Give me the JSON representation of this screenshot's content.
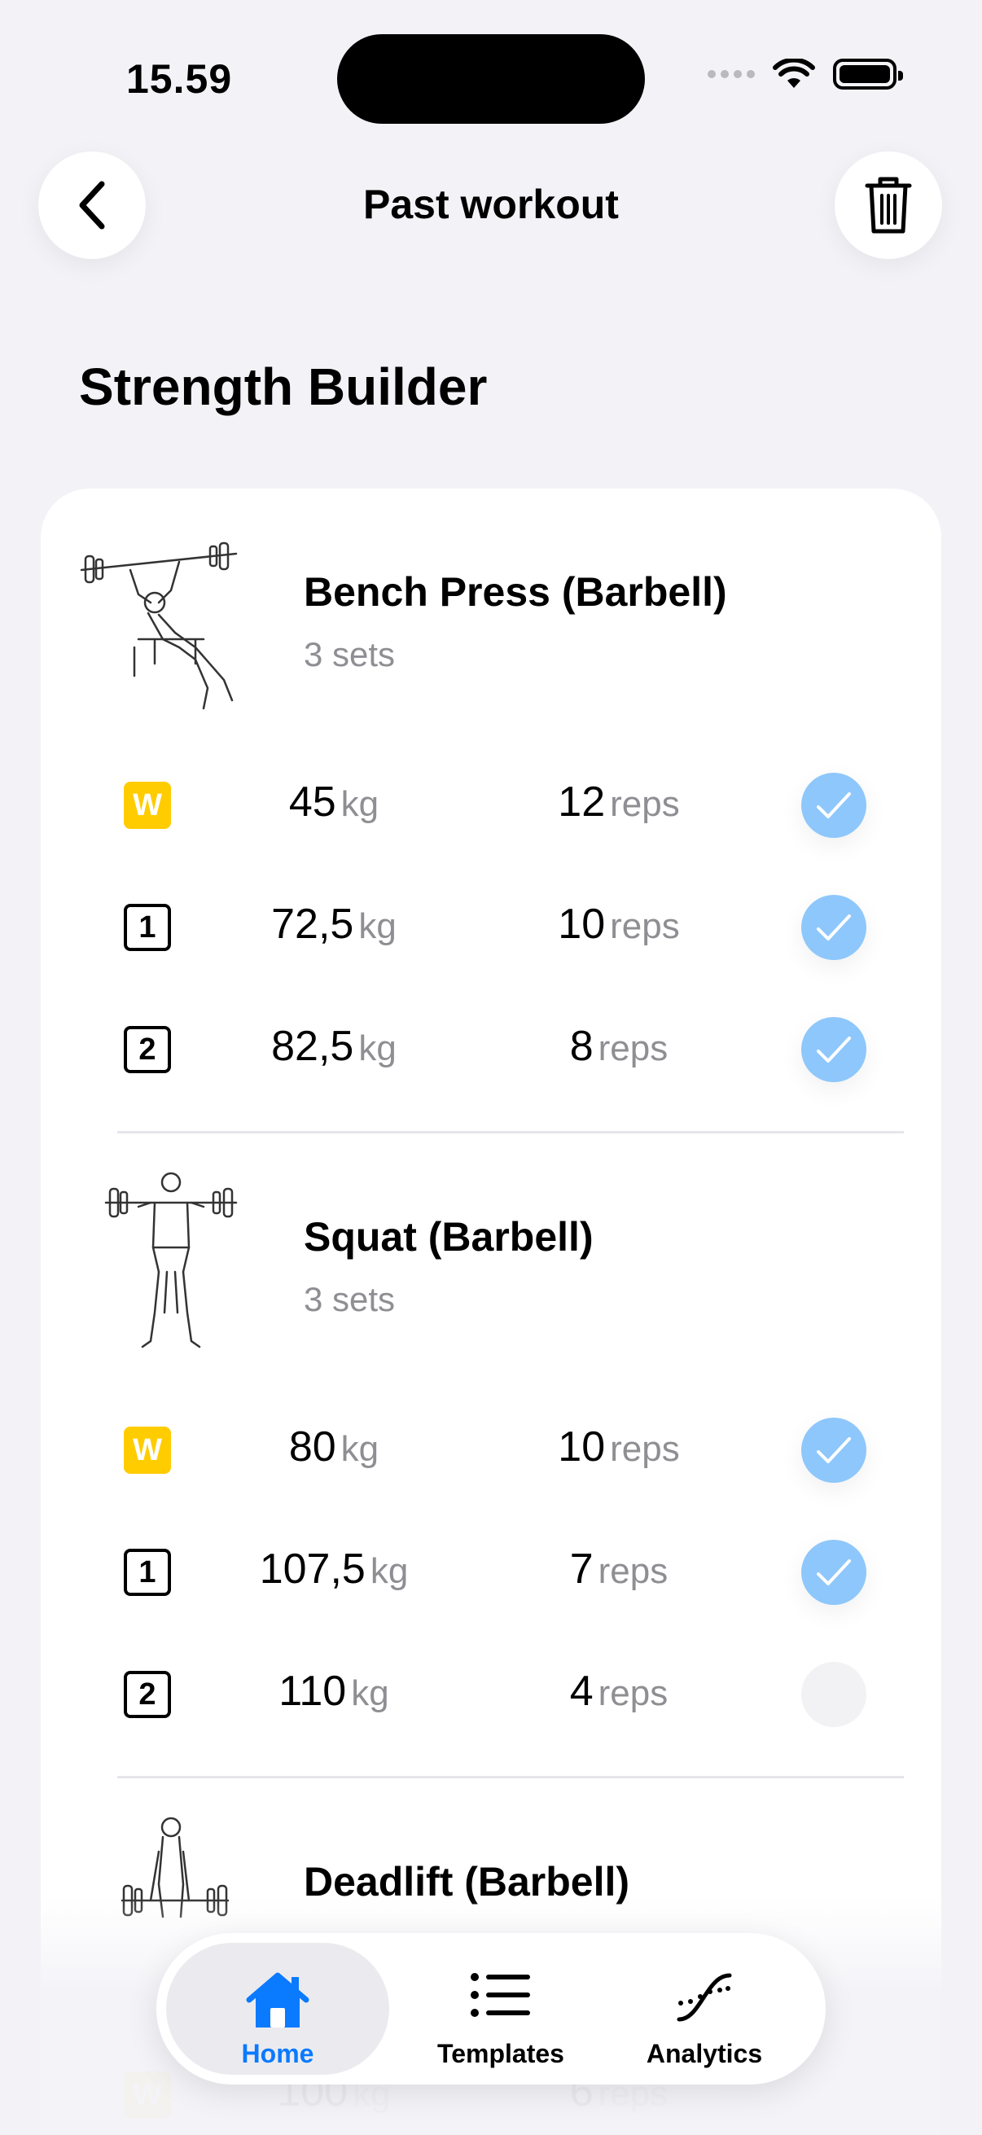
{
  "status": {
    "time": "15.59"
  },
  "header": {
    "title": "Past workout"
  },
  "workout": {
    "title": "Strength Builder"
  },
  "exercises": [
    {
      "name": "Bench Press (Barbell)",
      "sets_label": "3 sets",
      "sets": [
        {
          "badge": "W",
          "weight": "45",
          "weight_unit": "kg",
          "reps": "12",
          "reps_unit": "reps",
          "completed": true
        },
        {
          "badge": "1",
          "weight": "72,5",
          "weight_unit": "kg",
          "reps": "10",
          "reps_unit": "reps",
          "completed": true
        },
        {
          "badge": "2",
          "weight": "82,5",
          "weight_unit": "kg",
          "reps": "8",
          "reps_unit": "reps",
          "completed": true
        }
      ]
    },
    {
      "name": "Squat (Barbell)",
      "sets_label": "3 sets",
      "sets": [
        {
          "badge": "W",
          "weight": "80",
          "weight_unit": "kg",
          "reps": "10",
          "reps_unit": "reps",
          "completed": true
        },
        {
          "badge": "1",
          "weight": "107,5",
          "weight_unit": "kg",
          "reps": "7",
          "reps_unit": "reps",
          "completed": true
        },
        {
          "badge": "2",
          "weight": "110",
          "weight_unit": "kg",
          "reps": "4",
          "reps_unit": "reps",
          "completed": false
        }
      ]
    },
    {
      "name": "Deadlift (Barbell)",
      "sets": [
        {
          "badge": "W",
          "weight": "100",
          "weight_unit": "kg",
          "reps": "6",
          "reps_unit": "reps"
        }
      ]
    }
  ],
  "tabs": [
    {
      "label": "Home",
      "icon": "home-icon",
      "active": true
    },
    {
      "label": "Templates",
      "icon": "list-icon",
      "active": false
    },
    {
      "label": "Analytics",
      "icon": "analytics-icon",
      "active": false
    }
  ],
  "colors": {
    "accent": "#0a7aff",
    "check": "#8ec7fb",
    "warmup": "#ffcc00",
    "background": "#f2f2f7"
  }
}
